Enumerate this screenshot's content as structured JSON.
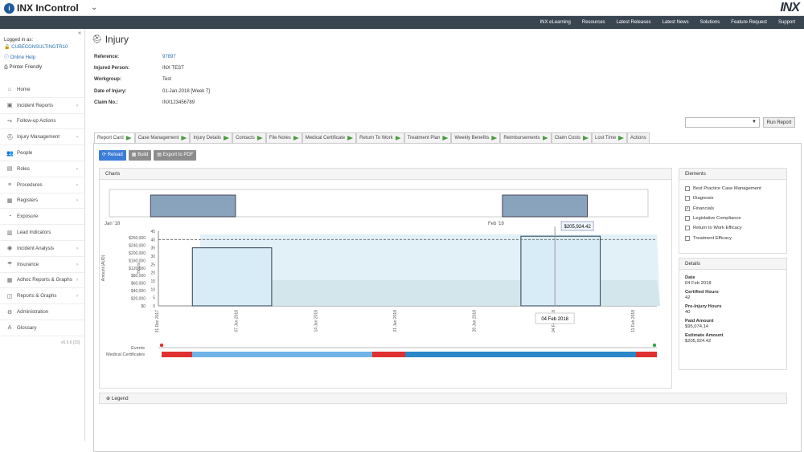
{
  "app": {
    "name": "INX InControl",
    "brand": "INX",
    "logo_letter": "i"
  },
  "nav": [
    "INX eLearning",
    "Resources",
    "Latest Releases",
    "Latest News",
    "Solutions",
    "Feature Request",
    "Support"
  ],
  "user": {
    "label": "Logged in as:",
    "account": "CUBECONSULTINGTR10",
    "help": "Online Help",
    "print": "Printer Friendly"
  },
  "menu": [
    {
      "label": "Home",
      "icon": "home-icon",
      "chev": false
    },
    {
      "label": "Incident Reports",
      "icon": "folder-icon",
      "chev": true
    },
    {
      "label": "Follow-up Actions",
      "icon": "arrow-icon",
      "chev": false
    },
    {
      "label": "Injury Management",
      "icon": "case-icon",
      "chev": true
    },
    {
      "label": "People",
      "icon": "people-icon",
      "chev": false
    },
    {
      "label": "Roles",
      "icon": "roles-icon",
      "chev": true
    },
    {
      "label": "Procedures",
      "icon": "list-icon",
      "chev": true
    },
    {
      "label": "Registers",
      "icon": "register-icon",
      "chev": true
    },
    {
      "label": "Exposure",
      "icon": "exposure-icon",
      "chev": false
    },
    {
      "label": "Lead Indicators",
      "icon": "indicator-icon",
      "chev": false
    },
    {
      "label": "Incident Analysis",
      "icon": "analysis-icon",
      "chev": true
    },
    {
      "label": "Insurance",
      "icon": "umbrella-icon",
      "chev": true
    },
    {
      "label": "Adhoc Reports & Graphs",
      "icon": "report-icon",
      "chev": true
    },
    {
      "label": "Reports & Graphs",
      "icon": "graph-icon",
      "chev": true
    },
    {
      "label": "Administration",
      "icon": "gear-icon",
      "chev": false
    },
    {
      "label": "Glossary",
      "icon": "glossary-icon",
      "chev": false
    }
  ],
  "version": "v6.5.6 [15]",
  "page": {
    "title": "Injury"
  },
  "info": [
    {
      "k": "Reference:",
      "v": "97897",
      "link": true
    },
    {
      "k": "Injured Person:",
      "v": "INX TEST",
      "link": false
    },
    {
      "k": "Workgroup:",
      "v": "Test",
      "link": false
    },
    {
      "k": "Date of Injury:",
      "v": "01-Jan-2018 [Week 7]",
      "link": false
    },
    {
      "k": "Claim No.:",
      "v": "INX123456789",
      "link": false
    }
  ],
  "run_report": "Run Report",
  "tabs": [
    "Report Card",
    "Case Management",
    "Injury Details",
    "Contacts",
    "File Notes",
    "Medical Certificate",
    "Return To Work",
    "Treatment Plan",
    "Weekly Benefits",
    "Reimbursements",
    "Claim Costs",
    "Lost Time",
    "Actions"
  ],
  "buttons": {
    "reload": "Reload",
    "build": "Build",
    "export": "Export to PDF"
  },
  "charts_header": "Charts",
  "legend_label": "Legend",
  "elements": {
    "header": "Elements",
    "items": [
      {
        "label": "Best Practice Case Management",
        "checked": false
      },
      {
        "label": "Diagnosis",
        "checked": false
      },
      {
        "label": "Financials",
        "checked": true
      },
      {
        "label": "Legislative Compliance",
        "checked": false
      },
      {
        "label": "Return to Work Efficacy",
        "checked": false
      },
      {
        "label": "Treatment Efficacy",
        "checked": false
      }
    ]
  },
  "details": {
    "header": "Details",
    "items": [
      {
        "k": "Date",
        "v": "04 Feb 2018"
      },
      {
        "k": "Certified Hours",
        "v": "42"
      },
      {
        "k": "Pre-Injury Hours",
        "v": "40"
      },
      {
        "k": "Paid Amount",
        "v": "$95,074.14"
      },
      {
        "k": "Estimate Amount",
        "v": "$205,924.42"
      }
    ]
  },
  "chart_data": {
    "type": "bar",
    "navigator_labels": [
      "Jan '18",
      "Feb '18"
    ],
    "x_ticks": [
      "31 Dec 2017",
      "07 Jan 2018",
      "14 Jan 2018",
      "21 Jan 2018",
      "28 Jan 2018",
      "04 Feb 2018",
      "11 Feb 2018"
    ],
    "y_left_label": "Amount (AUD)",
    "y_left_ticks": [
      "$0",
      "$20,000",
      "$40,000",
      "$60,000",
      "$80,000",
      "$120,000",
      "$160,000",
      "$200,000",
      "$240,000",
      "$260,000"
    ],
    "y_right_label": "Hours",
    "y_right_ticks": [
      "0",
      "5",
      "10",
      "15",
      "20",
      "25",
      "30",
      "35",
      "40",
      "45"
    ],
    "hours_series": [
      {
        "start": "2018-01-03",
        "end": "2018-01-10",
        "value": 35
      },
      {
        "start": "2018-02-01",
        "end": "2018-02-08",
        "value": 42
      }
    ],
    "pre_injury_hours": 40,
    "estimate_amount": 205924.42,
    "paid_amount": 95074.14,
    "tooltip_value": "$205,924.42",
    "tooltip_date": "04 Feb 2018",
    "lane_labels": [
      "Events",
      "Medical Certificates"
    ],
    "colors": {
      "bar": "#d8ecf7",
      "bar_stroke": "#2c3e50",
      "area": "#d6e9f5",
      "paid": "#cfe3e8",
      "red": "#e03030",
      "light_blue": "#6fb3e8",
      "dark_blue": "#2a87c8",
      "nav_bar": "#8aa3bd"
    }
  }
}
